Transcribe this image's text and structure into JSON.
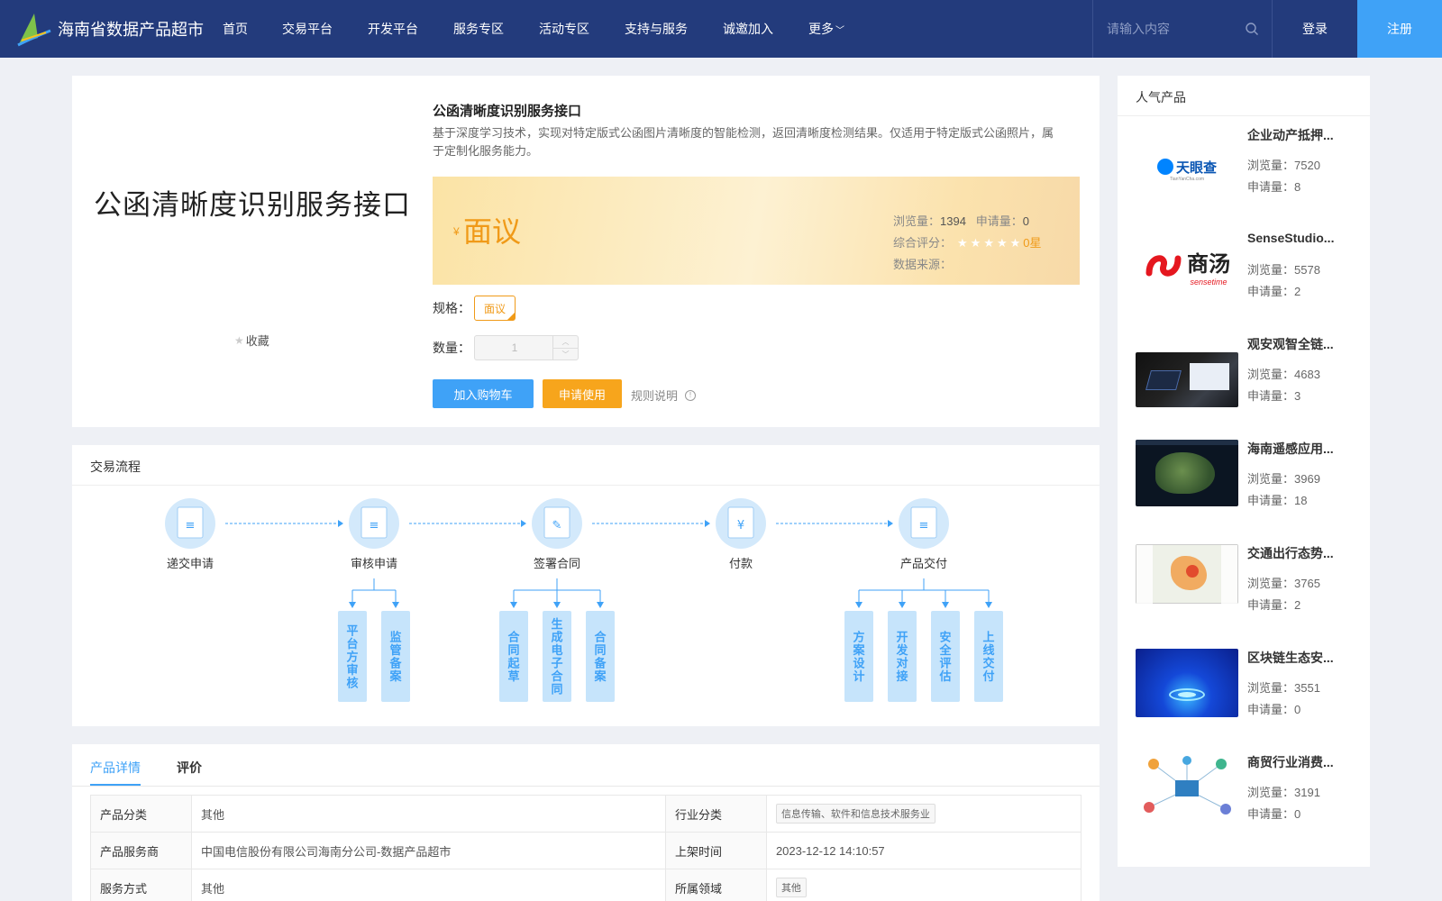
{
  "header": {
    "logo_title": "海南省数据产品超市",
    "nav": [
      "首页",
      "交易平台",
      "开发平台",
      "服务专区",
      "活动专区",
      "支持与服务",
      "诚邀加入",
      "更多"
    ],
    "search_placeholder": "请输入内容",
    "login": "登录",
    "register": "注册",
    "colors": {
      "bar": "#233b7c",
      "accent": "#3fa2f7"
    }
  },
  "product": {
    "image_text": "公函清晰度识别服务接口",
    "favorite_label": "收藏",
    "title": "公函清晰度识别服务接口",
    "description": "基于深度学习技术，实现对特定版式公函图片清晰度的智能检测，返回清晰度检测结果。仅适用于特定版式公函照片，属于定制化服务能力。",
    "currency": "¥",
    "price": "面议",
    "views_label": "浏览量：",
    "views": "1394",
    "applies_label": "申请量：",
    "applies": "0",
    "rating_label": "综合评分：",
    "rating_value": "0星",
    "rating_stars": 0,
    "source_label": "数据来源：",
    "spec_label": "规格：",
    "spec_value": "面议",
    "qty_label": "数量：",
    "qty_value": "1",
    "add_cart": "加入购物车",
    "apply": "申请使用",
    "rules": "规则说明"
  },
  "flow": {
    "title": "交易流程",
    "steps": [
      "递交申请",
      "审核申请",
      "签署合同",
      "付款",
      "产品交付"
    ],
    "substeps": {
      "审核申请": [
        "平台方审核",
        "监管备案"
      ],
      "签署合同": [
        "合同起草",
        "生成电子合同",
        "合同备案"
      ],
      "产品交付": [
        "方案设计",
        "开发对接",
        "安全评估",
        "上线交付"
      ]
    }
  },
  "detail": {
    "tabs": [
      "产品详情",
      "评价"
    ],
    "rows": [
      {
        "k1": "产品分类",
        "v1": "其他",
        "k2": "行业分类",
        "v2": "信息传输、软件和信息技术服务业"
      },
      {
        "k1": "产品服务商",
        "v1": "中国电信股份有限公司海南分公司-数据产品超市",
        "k2": "上架时间",
        "v2": "2023-12-12 14:10:57"
      },
      {
        "k1": "服务方式",
        "v1": "其他",
        "k2": "所属领域",
        "v2": "其他"
      }
    ]
  },
  "sidebar": {
    "title": "人气产品",
    "views_label": "浏览量：",
    "applies_label": "申请量：",
    "items": [
      {
        "name": "企业动产抵押...",
        "views": "7520",
        "applies": "8",
        "thumb": "tianyancha-logo"
      },
      {
        "name": "SenseStudio...",
        "views": "5578",
        "applies": "2",
        "thumb": "sensetime-logo"
      },
      {
        "name": "观安观智全链...",
        "views": "4683",
        "applies": "3",
        "thumb": "device-photo"
      },
      {
        "name": "海南遥感应用...",
        "views": "3969",
        "applies": "18",
        "thumb": "satellite-map"
      },
      {
        "name": "交通出行态势...",
        "views": "3765",
        "applies": "2",
        "thumb": "traffic-map"
      },
      {
        "name": "区块链生态安...",
        "views": "3551",
        "applies": "0",
        "thumb": "blockchain-art"
      },
      {
        "name": "商贸行业消费...",
        "views": "3191",
        "applies": "0",
        "thumb": "network-diagram"
      }
    ],
    "thumb_logo_texts": {
      "tianyancha": "天眼查",
      "tianyancha_sub": "TianYanCha.com",
      "sensetime_cn": "商汤",
      "sensetime_en": "sensetime"
    }
  }
}
